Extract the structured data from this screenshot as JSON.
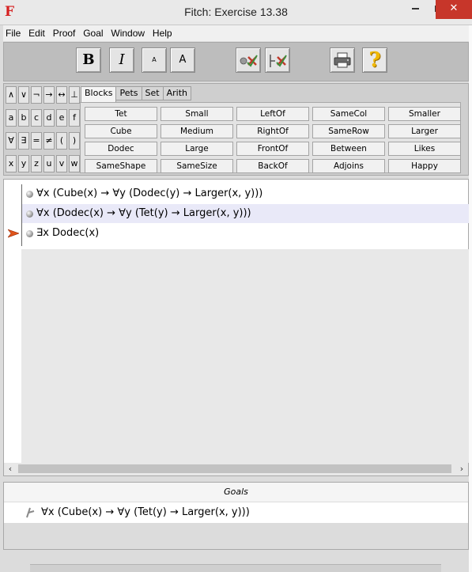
{
  "window": {
    "app_icon": "F",
    "title": "Fitch: Exercise 13.38"
  },
  "menu": [
    "File",
    "Edit",
    "Proof",
    "Goal",
    "Window",
    "Help"
  ],
  "toolbar": {
    "bold": "B",
    "italic": "I",
    "font_smaller": "A",
    "font_larger": "A",
    "help": "?"
  },
  "symbols": [
    [
      "∧",
      "∨",
      "¬",
      "→",
      "↔",
      "⊥"
    ],
    [
      "a",
      "b",
      "c",
      "d",
      "e",
      "f"
    ],
    [
      "∀",
      "∃",
      "=",
      "≠",
      "(",
      ")"
    ],
    [
      "x",
      "y",
      "z",
      "u",
      "v",
      "w"
    ]
  ],
  "tabs": [
    "Blocks",
    "Pets",
    "Set",
    "Arith"
  ],
  "active_tab": "Blocks",
  "predicates": [
    [
      "Tet",
      "Small",
      "LeftOf",
      "SameCol",
      "Smaller"
    ],
    [
      "Cube",
      "Medium",
      "RightOf",
      "SameRow",
      "Larger"
    ],
    [
      "Dodec",
      "Large",
      "FrontOf",
      "Between",
      "Likes"
    ],
    [
      "SameShape",
      "SameSize",
      "BackOf",
      "Adjoins",
      "Happy"
    ]
  ],
  "proof_lines": [
    "∀x (Cube(x) → ∀y (Dodec(y) → Larger(x, y)))",
    "∀x (Dodec(x) → ∀y (Tet(y) → Larger(x, y)))",
    "∃x Dodec(x)"
  ],
  "scroll": {
    "left": "‹",
    "right": "›"
  },
  "goals": {
    "header": "Goals",
    "items": [
      "∀x (Cube(x) → ∀y (Tet(y) → Larger(x, y)))"
    ]
  }
}
